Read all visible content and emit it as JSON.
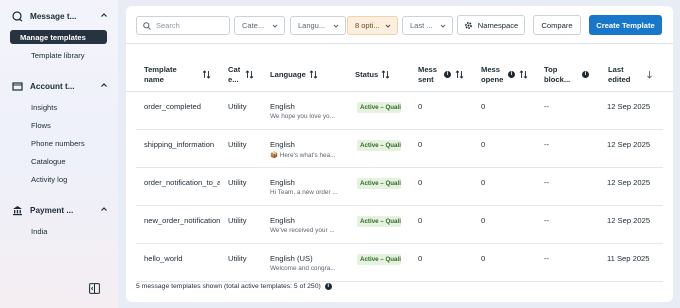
{
  "sidebar": {
    "sections": [
      {
        "title": "Message t...",
        "icon": "message-templates-icon"
      },
      {
        "title": "Account t...",
        "icon": "account-tools-icon"
      },
      {
        "title": "Payment ...",
        "icon": "payment-bank-icon"
      }
    ],
    "items": [
      {
        "label": "Manage templates",
        "active": true
      },
      {
        "label": "Template library"
      },
      {
        "label": "Insights"
      },
      {
        "label": "Flows"
      },
      {
        "label": "Phone numbers"
      },
      {
        "label": "Catalogue"
      },
      {
        "label": "Activity log"
      },
      {
        "label": "India"
      }
    ]
  },
  "toolbar": {
    "search_placeholder": "Search",
    "filters": [
      "Cate...",
      "Langu...",
      "8 opti...",
      "Last ..."
    ],
    "namespace_label": "Namespace",
    "compare_label": "Compare",
    "create_label": "Create Template"
  },
  "table": {
    "headers": {
      "name": [
        "Template",
        "name"
      ],
      "category": [
        "Cat",
        "e..."
      ],
      "language": "Language",
      "status": "Status",
      "sent": [
        "Mess",
        "sent"
      ],
      "opened": [
        "Mess",
        "opene"
      ],
      "top_block": [
        "Top",
        "block..."
      ],
      "edited": [
        "Last",
        "edited"
      ]
    },
    "rows": [
      {
        "name": "order_completed",
        "category": "Utility",
        "language": "English",
        "preview": "We hope you love yo...",
        "status": "Active – Quality pending",
        "sent": "0",
        "opened": "0",
        "top_block": "--",
        "edited": "12 Sep 2025"
      },
      {
        "name": "shipping_information",
        "category": "Utility",
        "language": "English",
        "preview": "📦 Here's what's hea...",
        "status": "Active – Quality pending",
        "sent": "0",
        "opened": "0",
        "top_block": "--",
        "edited": "12 Sep 2025"
      },
      {
        "name": "order_notification_to_a",
        "category": "Utility",
        "language": "English",
        "preview": "Hi Team, a new order ...",
        "status": "Active – Quality pending",
        "sent": "0",
        "opened": "0",
        "top_block": "--",
        "edited": "12 Sep 2025"
      },
      {
        "name": "new_order_notification",
        "category": "Utility",
        "language": "English",
        "preview": "We've received your ...",
        "status": "Active – Quality pending",
        "sent": "0",
        "opened": "0",
        "top_block": "--",
        "edited": "12 Sep 2025"
      },
      {
        "name": "hello_world",
        "category": "Utility",
        "language": "English (US)",
        "preview": "Welcome and congra...",
        "status": "Active – Quality pending",
        "sent": "0",
        "opened": "0",
        "top_block": "--",
        "edited": "11 Sep 2025"
      }
    ],
    "footer": "5 message templates shown (total active templates: 5 of 250)"
  },
  "colors": {
    "primary": "#1877c9",
    "active_nav": "#283341",
    "status_bg": "#e6f2df",
    "status_text": "#2f6b28"
  }
}
